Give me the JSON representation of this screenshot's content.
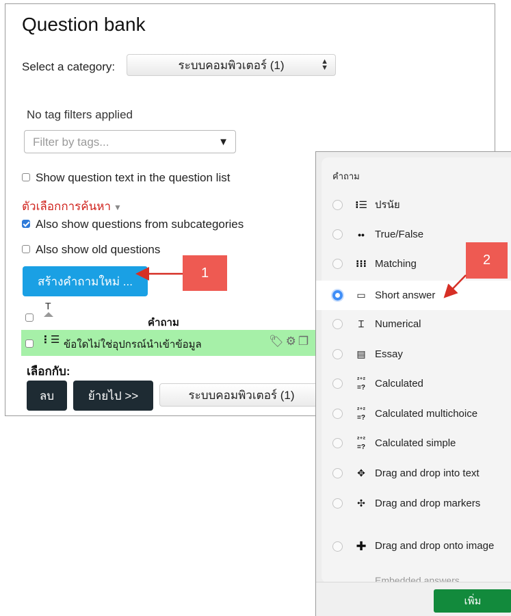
{
  "page": {
    "title": "Question bank"
  },
  "category": {
    "label": "Select a category:",
    "selected": "ระบบคอมพิวเตอร์ (1)"
  },
  "tags": {
    "status": "No tag filters applied",
    "placeholder": "Filter by tags..."
  },
  "options": {
    "show_text": "Show question text in the question list",
    "search_options": "ตัวเลือกการค้นหา",
    "subcategories": "Also show questions from subcategories",
    "old_questions": "Also show old questions"
  },
  "create_button": "สร้างคำถามใหม่ ...",
  "table": {
    "sort_label": "T",
    "column_question": "คำถาม",
    "rows": [
      {
        "text": "ข้อใดไม่ใช่อุปกรณ์นำเข้าข้อมูล"
      }
    ]
  },
  "bulk": {
    "with_selected": "เลือกกับ:",
    "delete": "ลบ",
    "move": "ย้ายไป >>",
    "target": "ระบบคอมพิวเตอร์ (1)"
  },
  "callouts": {
    "one": "1",
    "two": "2"
  },
  "chooser": {
    "heading": "คำถาม",
    "types": [
      {
        "label": "ปรนัย",
        "icon": "list-icon"
      },
      {
        "label": "True/False",
        "icon": "dots-icon"
      },
      {
        "label": "Matching",
        "icon": "matching-icon"
      },
      {
        "label": "Short answer",
        "icon": "short-answer-icon",
        "selected": true
      },
      {
        "label": "Numerical",
        "icon": "numerical-icon"
      },
      {
        "label": "Essay",
        "icon": "essay-icon"
      },
      {
        "label": "Calculated",
        "icon": "calculated-icon"
      },
      {
        "label": "Calculated multichoice",
        "icon": "calculated-multichoice-icon"
      },
      {
        "label": "Calculated simple",
        "icon": "calculated-simple-icon"
      },
      {
        "label": "Drag and drop into text",
        "icon": "ddwtos-icon"
      },
      {
        "label": "Drag and drop markers",
        "icon": "ddmarker-icon"
      },
      {
        "label": "Drag and drop onto image",
        "icon": "ddimage-icon"
      }
    ],
    "cut_item": "Embedded answers",
    "add_button": "เพิ่ม"
  },
  "colors": {
    "accent": "#1aa0e4",
    "callout": "#ee5a52",
    "row_highlight": "#a6f0a8",
    "add_button": "#128a3c",
    "dark_button": "#1e2b33"
  }
}
